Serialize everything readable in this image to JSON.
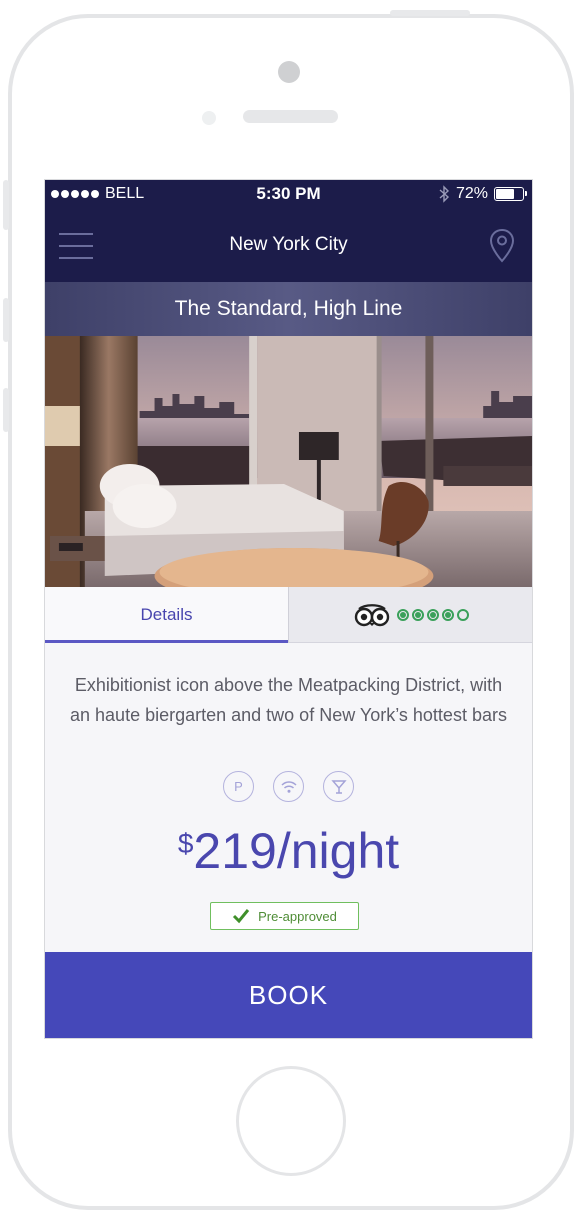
{
  "status_bar": {
    "carrier": "BELL",
    "time": "5:30 PM",
    "battery_percent": "72%",
    "battery_level": 0.72
  },
  "nav": {
    "title": "New York City",
    "menu_icon": "hamburger-icon",
    "location_icon": "map-pin-icon"
  },
  "hotel": {
    "name": "The Standard, High Line",
    "description": "Exhibitionist icon above the Meatpacking District, with an haute biergarten and two of New York’s hottest bars",
    "price_currency": "$",
    "price_text": "219/night",
    "badge": "Pre-approved",
    "amenities": [
      {
        "icon": "parking-icon",
        "glyph": "P"
      },
      {
        "icon": "wifi-icon"
      },
      {
        "icon": "cocktail-icon"
      }
    ]
  },
  "tabs": {
    "details_label": "Details",
    "reviews_icon": "tripadvisor-owl-icon",
    "rating": 4,
    "rating_max": 5
  },
  "book_label": "BOOK",
  "colors": {
    "header": "#1c1c4a",
    "accent": "#4548b9",
    "price": "#4a47ae",
    "rating": "#3aa05a",
    "badge": "#70bf5e"
  }
}
